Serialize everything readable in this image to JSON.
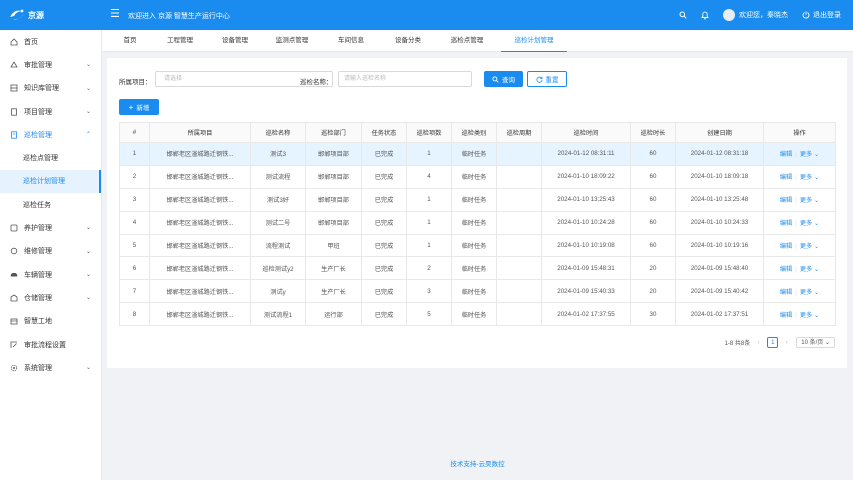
{
  "header": {
    "logo_text": "京源",
    "welcome": "欢迎进入 京源 智慧生产运行中心",
    "greeting": "欢迎您，秦晓杰",
    "logout": "退出登录",
    "colors": {
      "primary": "#1a8cf0"
    }
  },
  "sidebar": {
    "items": [
      {
        "label": "首页",
        "icon": "home-icon"
      },
      {
        "label": "审批管理",
        "icon": "approval-icon",
        "arrow": "⌄"
      },
      {
        "label": "知识库管理",
        "icon": "knowledge-icon",
        "arrow": "⌄"
      },
      {
        "label": "项目管理",
        "icon": "project-icon",
        "arrow": "⌄"
      },
      {
        "label": "巡检管理",
        "icon": "inspection-icon",
        "arrow": "⌃"
      },
      {
        "label": "巡检点管理",
        "sub": true
      },
      {
        "label": "巡检计划管理",
        "sub": true,
        "active": true
      },
      {
        "label": "巡检任务",
        "sub": true
      },
      {
        "label": "养护管理",
        "icon": "maintenance-icon",
        "arrow": "⌄"
      },
      {
        "label": "维修管理",
        "icon": "repair-icon",
        "arrow": "⌄"
      },
      {
        "label": "车辆管理",
        "icon": "vehicle-icon",
        "arrow": "⌄"
      },
      {
        "label": "仓储管理",
        "icon": "warehouse-icon",
        "arrow": "⌄"
      },
      {
        "label": "智慧工地",
        "icon": "site-icon"
      },
      {
        "label": "审批流程设置",
        "icon": "flow-icon"
      },
      {
        "label": "系统管理",
        "icon": "settings-icon",
        "arrow": "⌄"
      }
    ]
  },
  "tabs": [
    "首页",
    "工程管理",
    "设备管理",
    "监测点管理",
    "车间信息",
    "设备分类",
    "巡检点管理",
    "巡检计划管理"
  ],
  "filters": {
    "project_label": "所属项目：",
    "project_placeholder": "请选择",
    "name_label": "巡检名称：",
    "name_placeholder": "请输入巡检名称",
    "search_btn": "查询",
    "reset_btn": "重置",
    "add_btn": "新增"
  },
  "table": {
    "headers": [
      "#",
      "所属项目",
      "巡检名称",
      "巡检部门",
      "任务状态",
      "巡检项数",
      "巡检类别",
      "巡检周期",
      "巡检时间",
      "巡检时长",
      "创建日期",
      "操作"
    ],
    "rows": [
      [
        "1",
        "邯郸老区滏城路迁钢铁...",
        "测试3",
        "邯郸项目部",
        "已完成",
        "1",
        "临时任务",
        "",
        "2024-01-12 08:31:11",
        "60",
        "2024-01-12 08:31:18"
      ],
      [
        "2",
        "邯郸老区滏城路迁钢铁...",
        "测试流程",
        "邯郸项目部",
        "已完成",
        "4",
        "临时任务",
        "",
        "2024-01-10 18:09:22",
        "60",
        "2024-01-10 18:09:18"
      ],
      [
        "3",
        "邯郸老区滏城路迁钢铁...",
        "测试3好",
        "邯郸项目部",
        "已完成",
        "1",
        "临时任务",
        "",
        "2024-01-10 13:25:43",
        "60",
        "2024-01-10 13:25:48"
      ],
      [
        "4",
        "邯郸老区滏城路迁钢铁...",
        "测试二号",
        "邯郸项目部",
        "已完成",
        "1",
        "临时任务",
        "",
        "2024-01-10 10:24:28",
        "60",
        "2024-01-10 10:24:33"
      ],
      [
        "5",
        "邯郸老区滏城路迁钢铁...",
        "流程测试",
        "甲班",
        "已完成",
        "1",
        "临时任务",
        "",
        "2024-01-10 10:19:08",
        "60",
        "2024-01-10 10:19:16"
      ],
      [
        "6",
        "邯郸老区滏城路迁钢铁...",
        "巡检测试y2",
        "生产厂长",
        "已完成",
        "2",
        "临时任务",
        "",
        "2024-01-09 15:48:31",
        "20",
        "2024-01-09 15:48:40"
      ],
      [
        "7",
        "邯郸老区滏城路迁钢铁...",
        "测试y",
        "生产厂长",
        "已完成",
        "3",
        "临时任务",
        "",
        "2024-01-09 15:40:33",
        "20",
        "2024-01-09 15:40:42"
      ],
      [
        "8",
        "邯郸老区滏城路迁钢铁...",
        "测试流程1",
        "运行部",
        "已完成",
        "5",
        "临时任务",
        "",
        "2024-01-02 17:37:55",
        "30",
        "2024-01-02 17:37:51"
      ]
    ],
    "op_edit": "编辑",
    "op_more": "更多"
  },
  "pagination": {
    "summary": "1-8 共8条",
    "current": "1",
    "page_size": "10 条/页"
  },
  "footer": "技术支持-云昊数控"
}
